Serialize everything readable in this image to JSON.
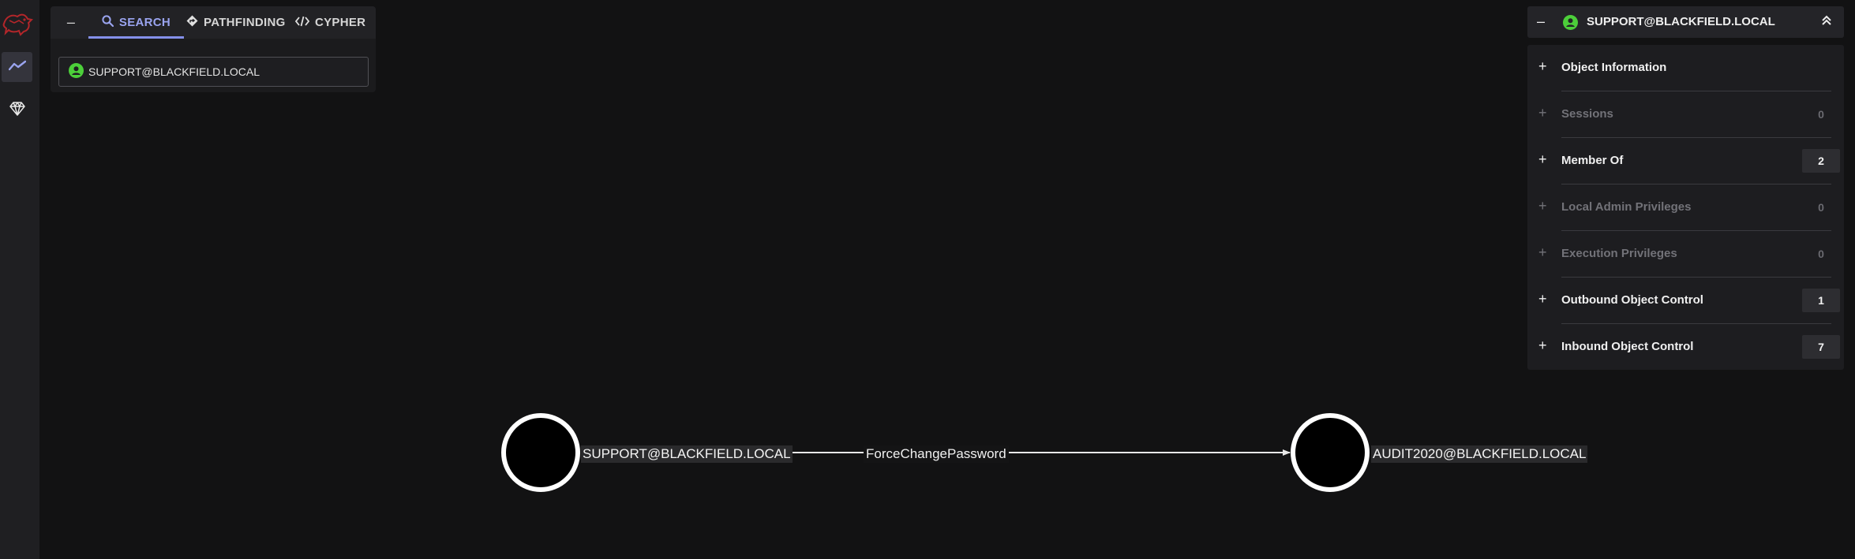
{
  "app": {
    "logo_icon": "bloodhound-logo",
    "nav": [
      {
        "icon": "explore-graph-icon",
        "active": true
      },
      {
        "icon": "gem-icon",
        "active": false
      }
    ]
  },
  "search_panel": {
    "collapse_icon": "minus-icon",
    "tabs": [
      {
        "label": "SEARCH",
        "icon": "search-icon",
        "active": true
      },
      {
        "label": "PATHFINDING",
        "icon": "diamond-direction-icon",
        "active": false
      },
      {
        "label": "CYPHER",
        "icon": "code-icon",
        "active": false
      }
    ],
    "search_value": "SUPPORT@BLACKFIELD.LOCAL"
  },
  "info_panel": {
    "title": "SUPPORT@BLACKFIELD.LOCAL",
    "sections": [
      {
        "label": "Object Information",
        "count": null,
        "enabled": true,
        "plus": "+"
      },
      {
        "label": "Sessions",
        "count": "0",
        "enabled": false,
        "plus": "+"
      },
      {
        "label": "Member Of",
        "count": "2",
        "enabled": true,
        "plus": "+"
      },
      {
        "label": "Local Admin Privileges",
        "count": "0",
        "enabled": false,
        "plus": "+"
      },
      {
        "label": "Execution Privileges",
        "count": "0",
        "enabled": false,
        "plus": "+"
      },
      {
        "label": "Outbound Object Control",
        "count": "1",
        "enabled": true,
        "plus": "+"
      },
      {
        "label": "Inbound Object Control",
        "count": "7",
        "enabled": true,
        "plus": "+"
      }
    ]
  },
  "graph": {
    "nodes": [
      {
        "label": "SUPPORT@BLACKFIELD.LOCAL"
      },
      {
        "label": "AUDIT2020@BLACKFIELD.LOCAL"
      }
    ],
    "edges": [
      {
        "label": "ForceChangePassword"
      }
    ]
  },
  "colors": {
    "accent": "#8590ea",
    "user_icon": "#4ccf3a",
    "logo": "#c0282a",
    "background": "#121213"
  }
}
